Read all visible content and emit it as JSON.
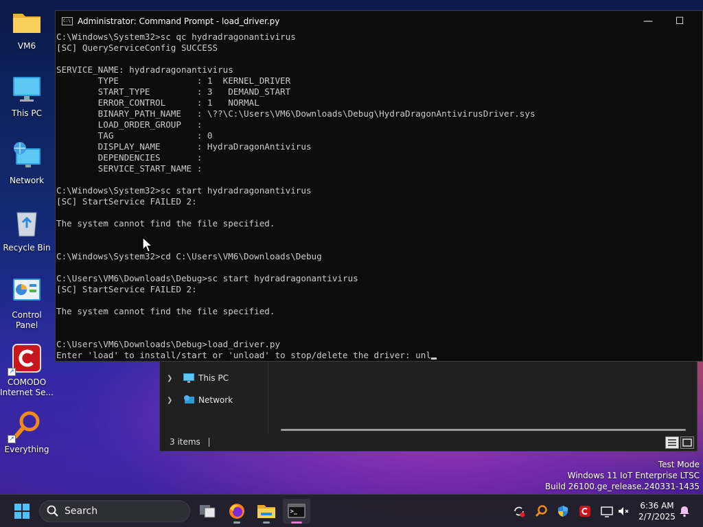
{
  "desktop_icons": [
    {
      "label": "VM6",
      "icon": "folder-icon"
    },
    {
      "label": "This PC",
      "icon": "monitor-icon"
    },
    {
      "label": "Network",
      "icon": "network-icon"
    },
    {
      "label": "Recycle Bin",
      "icon": "recycle-bin-icon"
    },
    {
      "label": "Control Panel",
      "icon": "control-panel-icon"
    },
    {
      "label": "COMODO Internet Se...",
      "icon": "comodo-icon"
    },
    {
      "label": "Everything",
      "icon": "everything-search-icon"
    }
  ],
  "cmd": {
    "title": "Administrator: Command Prompt - load_driver.py",
    "lines": [
      "C:\\Windows\\System32>sc qc hydradragonantivirus",
      "[SC] QueryServiceConfig SUCCESS",
      "",
      "SERVICE_NAME: hydradragonantivirus",
      "        TYPE               : 1  KERNEL_DRIVER",
      "        START_TYPE         : 3   DEMAND_START",
      "        ERROR_CONTROL      : 1   NORMAL",
      "        BINARY_PATH_NAME   : \\??\\C:\\Users\\VM6\\Downloads\\Debug\\HydraDragonAntivirusDriver.sys",
      "        LOAD_ORDER_GROUP   :",
      "        TAG                : 0",
      "        DISPLAY_NAME       : HydraDragonAntivirus",
      "        DEPENDENCIES       :",
      "        SERVICE_START_NAME :",
      "",
      "C:\\Windows\\System32>sc start hydradragonantivirus",
      "[SC] StartService FAILED 2:",
      "",
      "The system cannot find the file specified.",
      "",
      "",
      "C:\\Windows\\System32>cd C:\\Users\\VM6\\Downloads\\Debug",
      "",
      "C:\\Users\\VM6\\Downloads\\Debug>sc start hydradragonantivirus",
      "[SC] StartService FAILED 2:",
      "",
      "The system cannot find the file specified.",
      "",
      "",
      "C:\\Users\\VM6\\Downloads\\Debug>load_driver.py"
    ],
    "prompt_line": "Enter 'load' to install/start or 'unload' to stop/delete the driver: ",
    "input_value": "unl",
    "controls": {
      "minimize": "—",
      "maximize": "☐"
    }
  },
  "explorer": {
    "nav_items": [
      {
        "label": "This PC",
        "icon": "monitor-icon"
      },
      {
        "label": "Network",
        "icon": "network-icon"
      }
    ],
    "status": "3 items"
  },
  "watermark": {
    "line1": "Test Mode",
    "line2": "Windows 11 IoT Enterprise LTSC",
    "line3": "Build 26100.ge_release.240331-1435"
  },
  "taskbar": {
    "search_placeholder": "Search",
    "pinned": [
      "start-icon",
      "task-view-icon",
      "firefox-icon",
      "file-explorer-icon",
      "terminal-icon"
    ],
    "tray": [
      "sync-icon",
      "everything-search-icon",
      "security-shield-icon",
      "comodo-icon",
      "display-icon",
      "mute-icon"
    ],
    "time": "6:36 AM",
    "date": "2/7/2025"
  },
  "colors": {
    "console_bg": "#0c0c0c",
    "console_fg": "#cccccc",
    "accent_pink": "#e27ad0"
  }
}
